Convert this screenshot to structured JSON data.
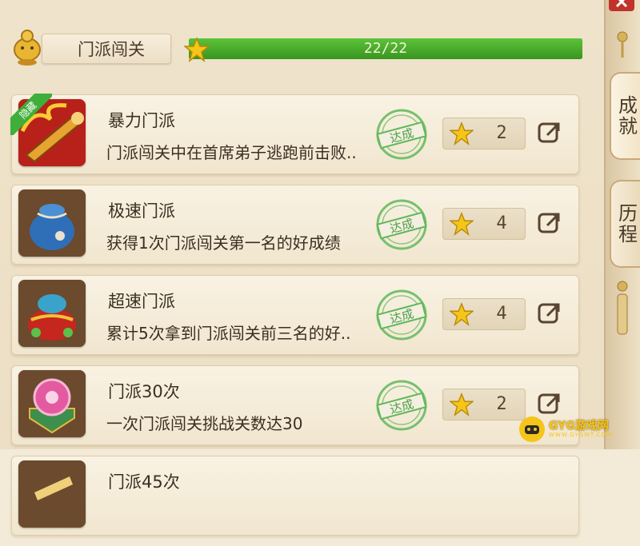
{
  "header": {
    "title": "门派闯关",
    "progress_text": "22/22",
    "progress_fraction": 1.0
  },
  "achievements": [
    {
      "name": "暴力门派",
      "desc": "门派闯关中在首席弟子逃跑前击败..",
      "badge": "隐藏",
      "status": "达成",
      "reward": "2",
      "icon": "scroll-fire-icon"
    },
    {
      "name": "极速门派",
      "desc": "获得1次门派闯关第一名的好成绩",
      "status": "达成",
      "reward": "4",
      "icon": "pouch-icon"
    },
    {
      "name": "超速门派",
      "desc": "累计5次拿到门派闯关前三名的好..",
      "status": "达成",
      "reward": "4",
      "icon": "treasure-bag-icon"
    },
    {
      "name": "门派30次",
      "desc": "一次门派闯关挑战关数达30",
      "status": "达成",
      "reward": "2",
      "icon": "crystal-orb-icon"
    },
    {
      "name": "门派45次",
      "desc": "",
      "status": "",
      "reward": "",
      "icon": "scroll-icon"
    }
  ],
  "side_tabs": {
    "achievement": "成就",
    "history": "历程"
  },
  "watermark": {
    "text": "GYG游戏网",
    "sub": "WWW.GYGWT.COM"
  },
  "colors": {
    "progress_fill": "#38951f",
    "stamp": "#5fb85a",
    "star": "#f5c518"
  }
}
